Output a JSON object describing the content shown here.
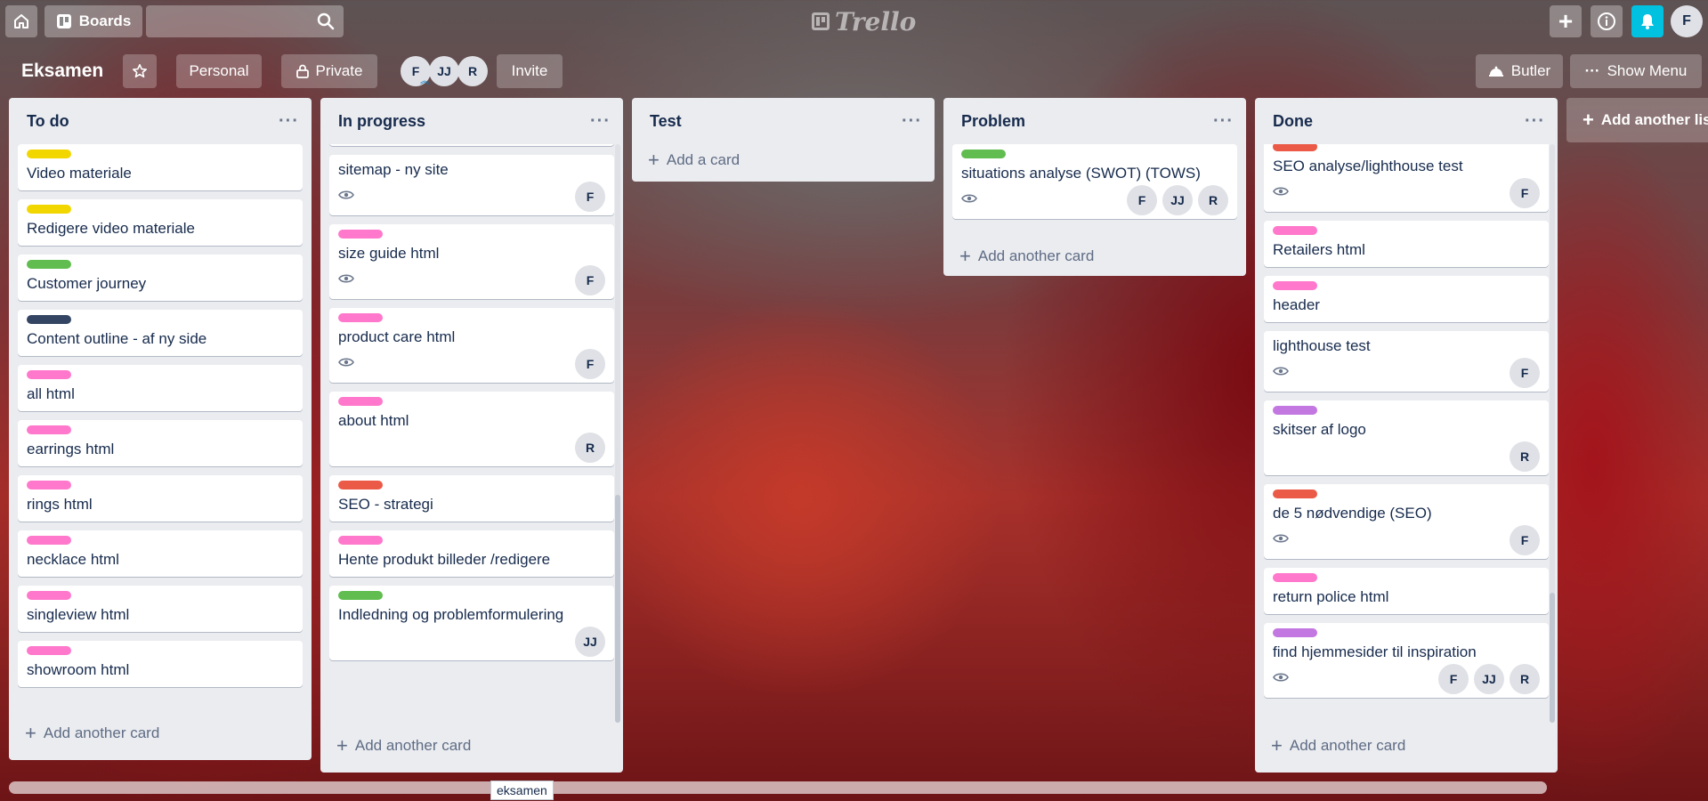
{
  "topbar": {
    "home_icon": "home-icon",
    "boards_label": "Boards",
    "search_placeholder": "",
    "logo_text": "Trello"
  },
  "board": {
    "title": "Eksamen",
    "personal_label": "Personal",
    "private_label": "Private",
    "members": [
      "F",
      "JJ",
      "R"
    ],
    "invite_label": "Invite",
    "butler_label": "Butler",
    "menu_label": "Show Menu",
    "user_initial": "F"
  },
  "colors": {
    "yellow": "#f2d600",
    "green": "#61bd4f",
    "navy": "#344563",
    "pink": "#ff78cb",
    "red": "#eb5a46",
    "purple": "#c377e0",
    "notify": "#00c2e0"
  },
  "lists": [
    {
      "title": "To do",
      "add_label": "Add another card",
      "cards": [
        {
          "title": "Video materiale",
          "label": "yellow"
        },
        {
          "title": "Redigere video materiale",
          "label": "yellow"
        },
        {
          "title": "Customer journey",
          "label": "green"
        },
        {
          "title": "Content outline - af ny side",
          "label": "navy"
        },
        {
          "title": "all html",
          "label": "pink"
        },
        {
          "title": "earrings html",
          "label": "pink"
        },
        {
          "title": "rings html",
          "label": "pink"
        },
        {
          "title": "necklace html",
          "label": "pink"
        },
        {
          "title": "singleview html",
          "label": "pink"
        },
        {
          "title": "showroom html",
          "label": "pink"
        }
      ]
    },
    {
      "title": "In progress",
      "add_label": "Add another card",
      "cards": [
        {
          "title": "sitemap - ny site",
          "watch": true,
          "members": [
            "F"
          ]
        },
        {
          "title": "size guide html",
          "label": "pink",
          "watch": true,
          "members": [
            "F"
          ]
        },
        {
          "title": "product care html",
          "label": "pink",
          "watch": true,
          "members": [
            "F"
          ]
        },
        {
          "title": "about html",
          "label": "pink",
          "members": [
            "R"
          ]
        },
        {
          "title": "SEO - strategi",
          "label": "red"
        },
        {
          "title": "Hente produkt billeder /redigere",
          "label": "pink"
        },
        {
          "title": "Indledning og problemformulering",
          "label": "green",
          "members": [
            "JJ"
          ]
        }
      ]
    },
    {
      "title": "Test",
      "add_label": "Add a card",
      "cards": []
    },
    {
      "title": "Problem",
      "add_label": "Add another card",
      "cards": [
        {
          "title": "situations analyse (SWOT) (TOWS)",
          "label": "green",
          "watch": true,
          "members": [
            "F",
            "JJ",
            "R"
          ]
        }
      ]
    },
    {
      "title": "Done",
      "add_label": "Add another card",
      "cards": [
        {
          "title": "SEO analyse/lighthouse test",
          "label": "red",
          "watch": true,
          "members": [
            "F"
          ]
        },
        {
          "title": "Retailers html",
          "label": "pink"
        },
        {
          "title": "header",
          "label": "pink"
        },
        {
          "title": "lighthouse test",
          "watch": true,
          "members": [
            "F"
          ]
        },
        {
          "title": "skitser af logo",
          "label": "purple",
          "members": [
            "R"
          ]
        },
        {
          "title": "de 5 nødvendige (SEO)",
          "label": "red",
          "watch": true,
          "members": [
            "F"
          ]
        },
        {
          "title": "return police html",
          "label": "pink"
        },
        {
          "title": "find hjemmesider til inspiration",
          "label": "purple",
          "watch": true,
          "members": [
            "F",
            "JJ",
            "R"
          ]
        }
      ]
    }
  ],
  "add_list_label": "Add another list",
  "tooltip": "eksamen"
}
